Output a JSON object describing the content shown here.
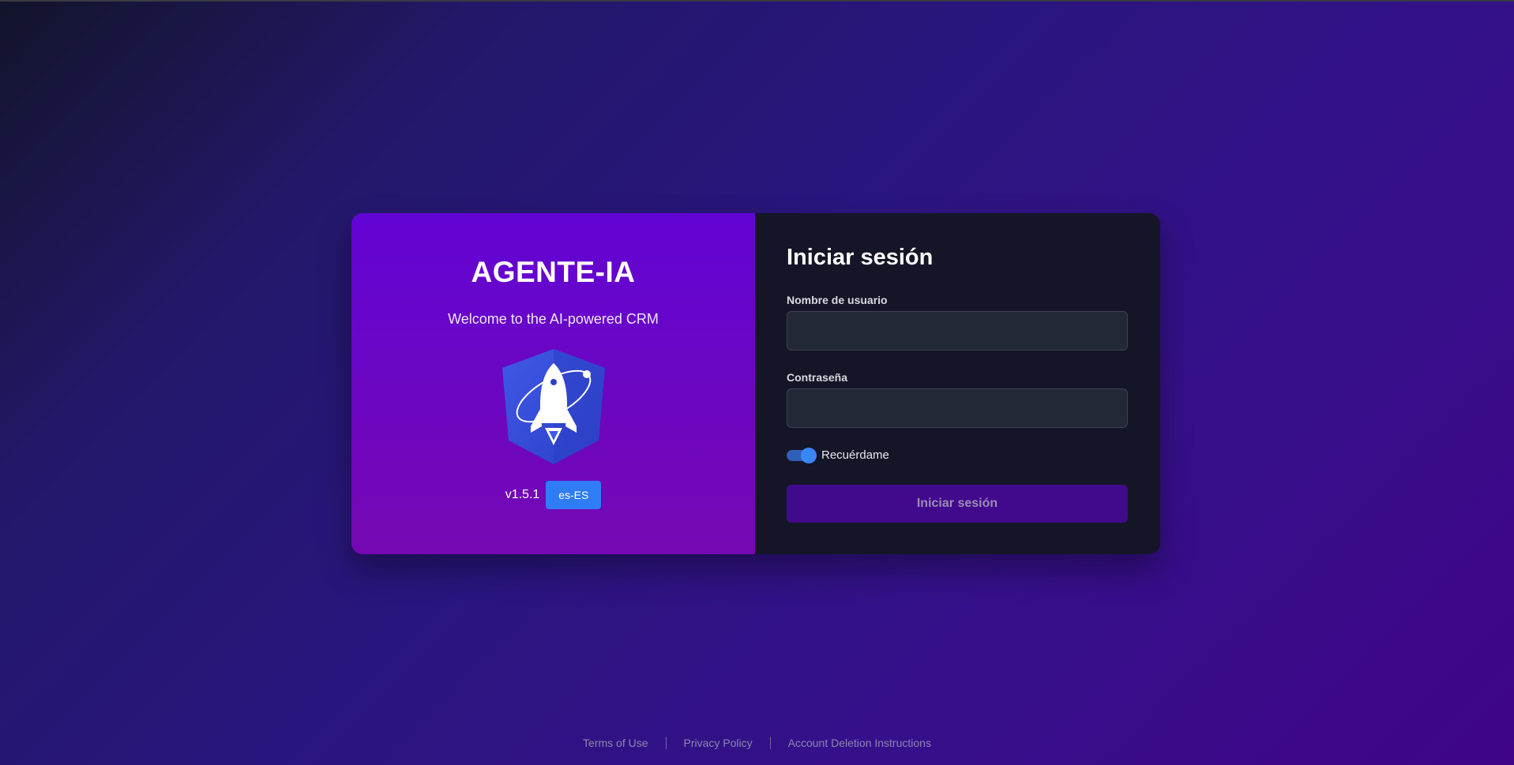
{
  "branding": {
    "app_name": "AGENTE-IA",
    "tagline": "Welcome to the AI-powered CRM",
    "logo_icon": "rocket-shield-icon",
    "version": "v1.5.1",
    "language_button": "es-ES"
  },
  "login": {
    "title": "Iniciar sesión",
    "username_label": "Nombre de usuario",
    "username_value": "",
    "password_label": "Contraseña",
    "password_value": "",
    "remember_label": "Recuérdame",
    "remember_checked": true,
    "submit_label": "Iniciar sesión"
  },
  "footer": {
    "links": [
      "Terms of Use",
      "Privacy Policy",
      "Account Deletion Instructions"
    ]
  },
  "colors": {
    "accent": "#2e7cf6",
    "left_panel_top": "#6204d4",
    "left_panel_bottom": "#7508b2",
    "right_panel": "#141627",
    "submit_button": "#410a8c"
  }
}
